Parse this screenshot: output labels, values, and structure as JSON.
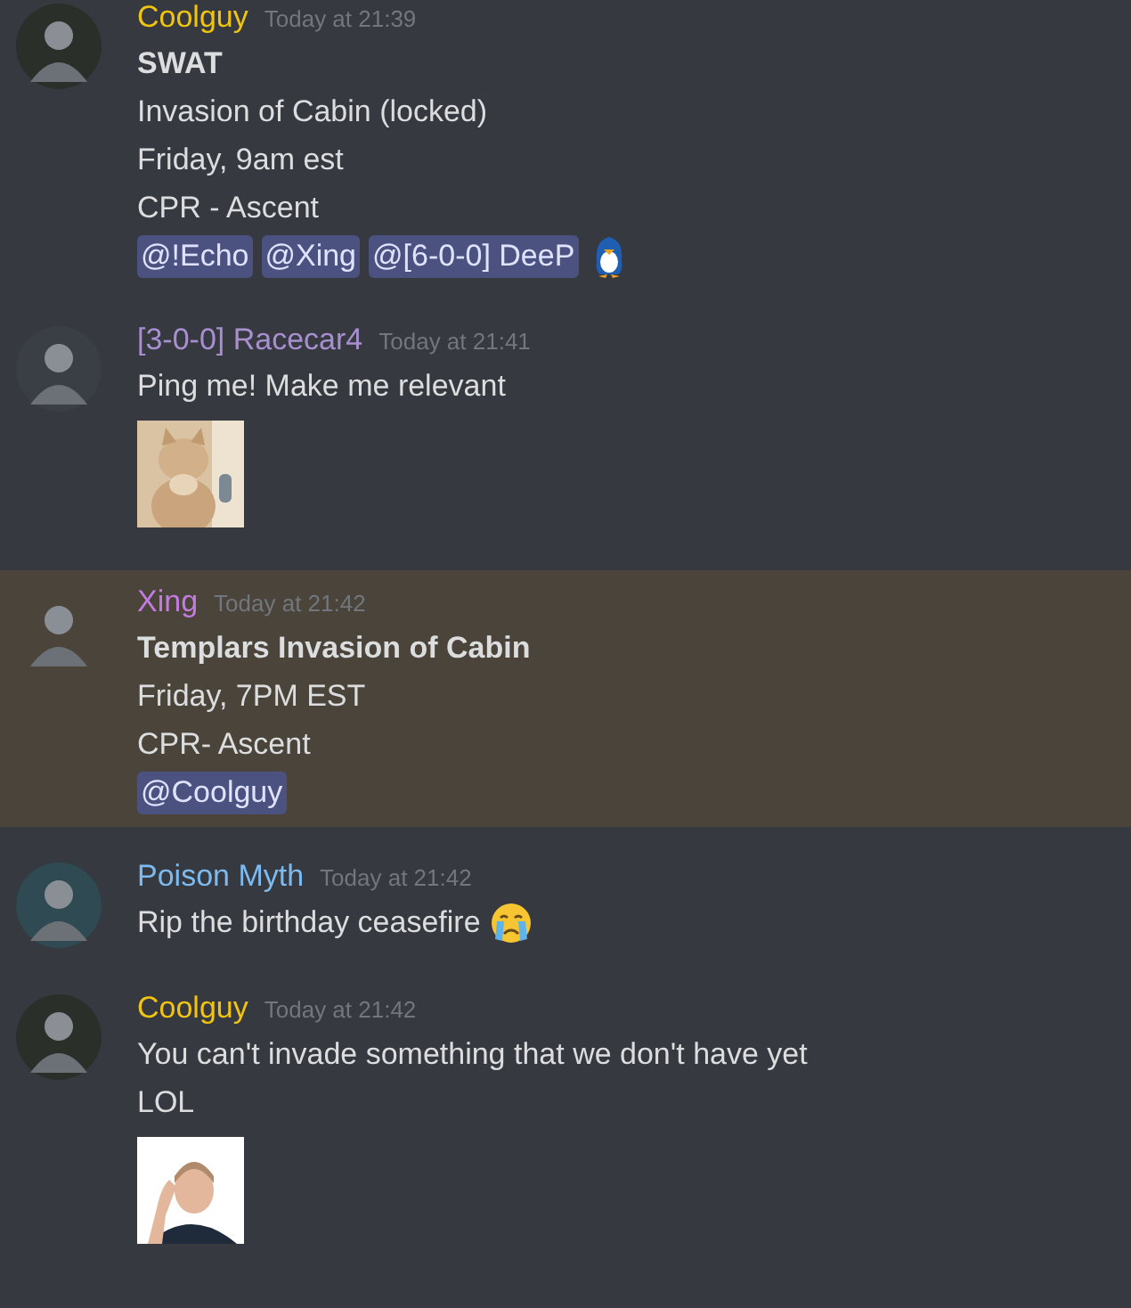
{
  "messages": [
    {
      "author": "Coolguy",
      "color": "#f1c40f",
      "timestamp": "Today at 21:39",
      "highlighted": false,
      "avatar": {
        "kind": "picture"
      },
      "lines": [
        {
          "kind": "title",
          "parts": [
            {
              "kind": "text",
              "text": "SWAT"
            }
          ]
        },
        {
          "kind": "text",
          "parts": [
            {
              "kind": "text",
              "text": "Invasion of Cabin (locked)"
            }
          ]
        },
        {
          "kind": "text",
          "parts": [
            {
              "kind": "text",
              "text": "Friday, 9am est"
            }
          ]
        },
        {
          "kind": "text",
          "parts": [
            {
              "kind": "text",
              "text": "CPR - Ascent"
            }
          ]
        },
        {
          "kind": "text",
          "parts": [
            {
              "kind": "mention",
              "text": "@!Echo"
            },
            {
              "kind": "mention",
              "text": "@Xing"
            },
            {
              "kind": "mention",
              "text": "@[6-0-0] DeeP"
            },
            {
              "kind": "penguin"
            }
          ]
        }
      ]
    },
    {
      "author": "[3-0-0] Racecar4",
      "color": "#a78fd0",
      "timestamp": "Today at 21:41",
      "highlighted": false,
      "avatar": {
        "kind": "picture"
      },
      "lines": [
        {
          "kind": "text",
          "parts": [
            {
              "kind": "text",
              "text": "Ping me! Make me relevant"
            }
          ]
        },
        {
          "kind": "picture"
        }
      ]
    },
    {
      "author": "Xing",
      "color": "#c27ce0",
      "timestamp": "Today at 21:42",
      "highlighted": true,
      "avatar": {
        "kind": "picture"
      },
      "lines": [
        {
          "kind": "title",
          "parts": [
            {
              "kind": "text",
              "text": "Templars Invasion of Cabin"
            }
          ]
        },
        {
          "kind": "text",
          "parts": [
            {
              "kind": "text",
              "text": "Friday, 7PM EST"
            }
          ]
        },
        {
          "kind": "text",
          "parts": [
            {
              "kind": "text",
              "text": "CPR- Ascent"
            }
          ]
        },
        {
          "kind": "text",
          "parts": [
            {
              "kind": "mention",
              "text": "@Coolguy"
            }
          ]
        }
      ]
    },
    {
      "author": "Poison Myth",
      "color": "#7cbaf0",
      "timestamp": "Today at 21:42",
      "highlighted": false,
      "avatar": {
        "kind": "picture"
      },
      "lines": [
        {
          "kind": "text",
          "parts": [
            {
              "kind": "text",
              "text": "Rip the birthday ceasefire"
            },
            {
              "kind": "crying"
            }
          ]
        }
      ]
    },
    {
      "author": "Coolguy",
      "color": "#f1c40f",
      "timestamp": "Today at 21:42",
      "highlighted": false,
      "avatar": {
        "kind": "picture"
      },
      "lines": [
        {
          "kind": "text",
          "parts": [
            {
              "kind": "text",
              "text": "You can't invade something that we don't have yet"
            }
          ]
        },
        {
          "kind": "text",
          "parts": [
            {
              "kind": "text",
              "text": "LOL"
            }
          ]
        },
        {
          "kind": "picture"
        }
      ]
    }
  ]
}
